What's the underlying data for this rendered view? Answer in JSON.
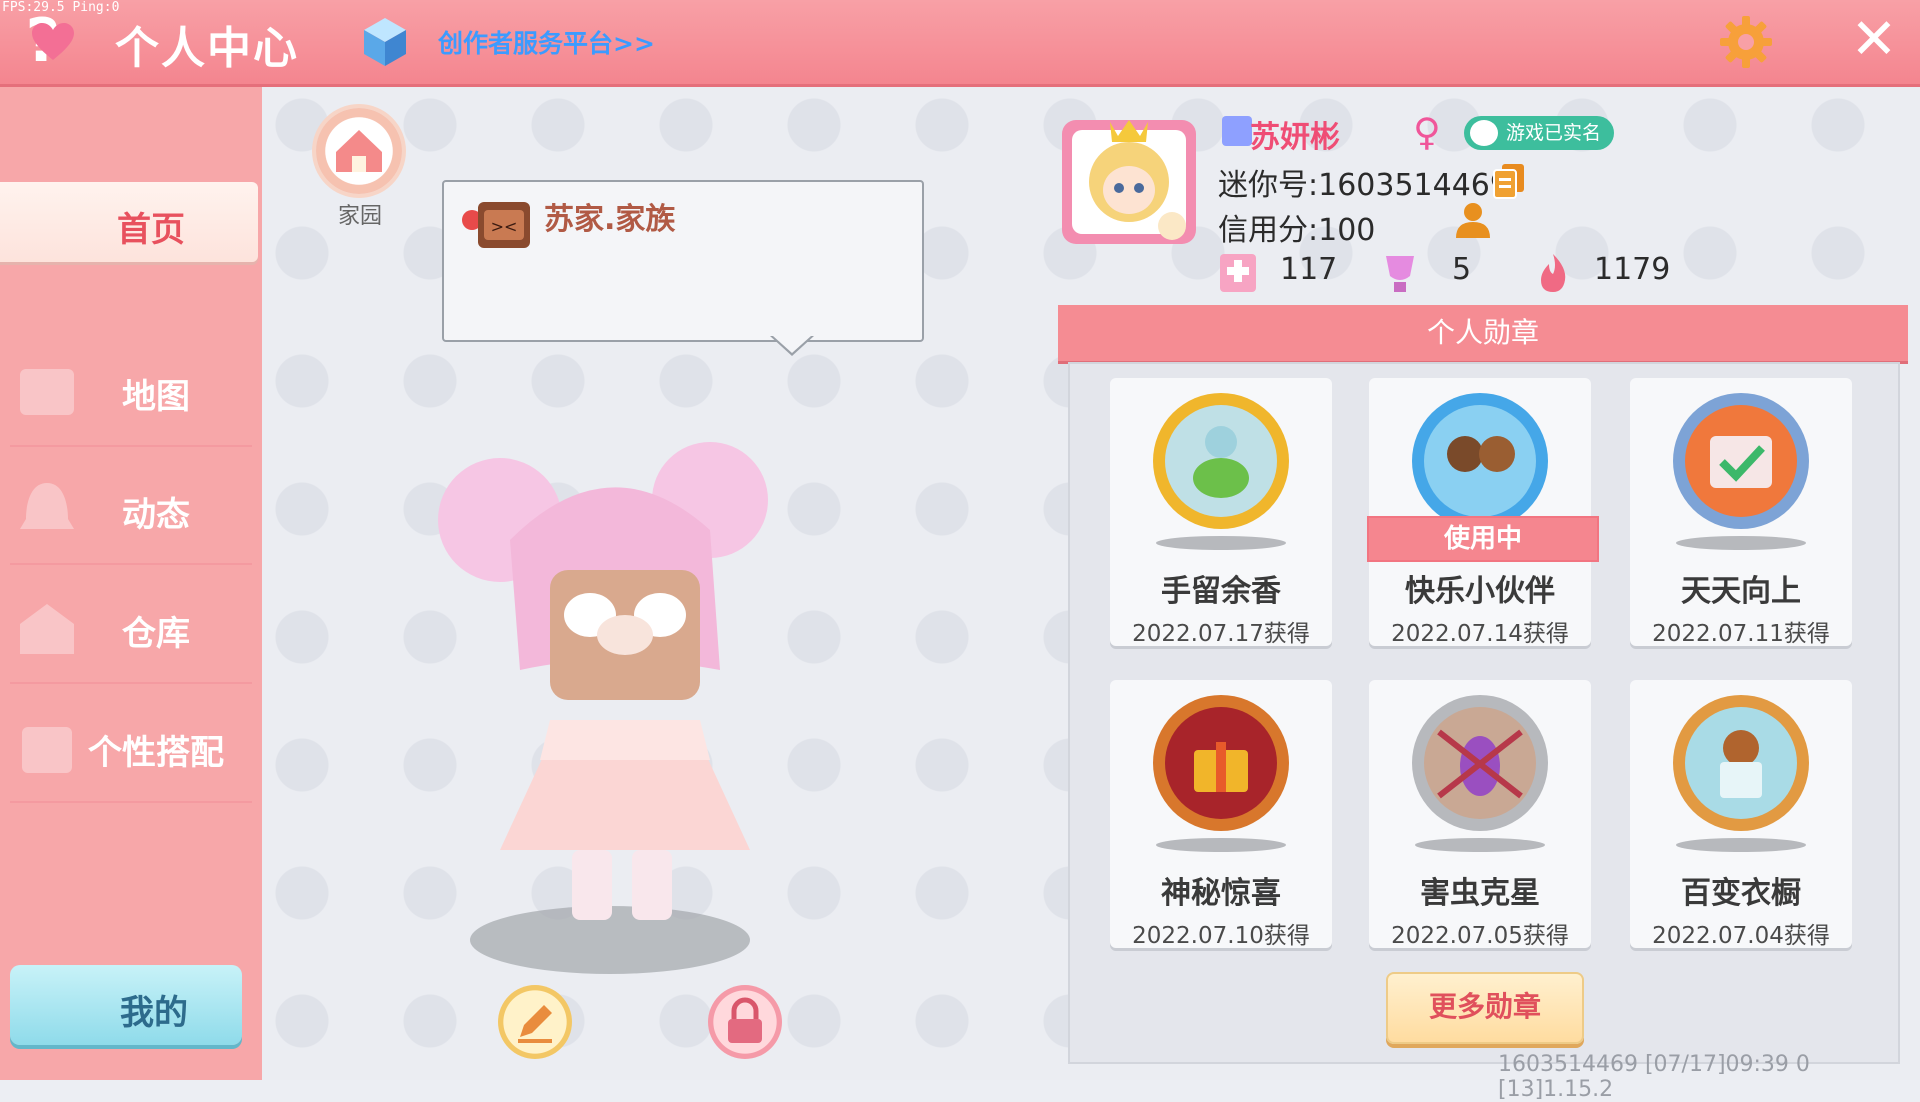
{
  "debug": {
    "fps_text": "FPS:29.5  Ping:0"
  },
  "header": {
    "help_label": "?",
    "title": "个人中心",
    "creator_link": "创作者服务平台>>",
    "close_label": "✕"
  },
  "sidebar": {
    "items": [
      {
        "label": "首页",
        "icon": "home-bg-icon",
        "selected": true
      },
      {
        "label": "地图",
        "icon": "map-bg-icon"
      },
      {
        "label": "动态",
        "icon": "bell-bg-icon"
      },
      {
        "label": "仓库",
        "icon": "storage-bg-icon"
      },
      {
        "label": "个性搭配",
        "icon": "dress-bg-icon"
      }
    ],
    "mine_label": "我的"
  },
  "home": {
    "label": "家园"
  },
  "clan": {
    "name": "苏家.家族"
  },
  "profile": {
    "name": "苏妍彬",
    "female_symbol": "♀",
    "verified_text": "游戏已实名",
    "mini_id": "迷你号:1603514469",
    "credit": "信用分:100",
    "stats": {
      "likes": "117",
      "trophies": "5",
      "popularity": "1179"
    }
  },
  "medals": {
    "title": "个人勋章",
    "in_use_label": "使用中",
    "items": [
      {
        "name": "手留余香",
        "date": "2022.07.17获得",
        "color": "#f0b62c"
      },
      {
        "name": "快乐小伙伴",
        "date": "2022.07.14获得",
        "color": "#45a7e8",
        "in_use": true
      },
      {
        "name": "天天向上",
        "date": "2022.07.11获得",
        "color": "#7da3d6"
      },
      {
        "name": "神秘惊喜",
        "date": "2022.07.10获得",
        "color": "#d8772c"
      },
      {
        "name": "害虫克星",
        "date": "2022.07.05获得",
        "color": "#b7b9bd"
      },
      {
        "name": "百变衣橱",
        "date": "2022.07.04获得",
        "color": "#e29a42"
      }
    ],
    "more_label": "更多勋章"
  },
  "footer": {
    "info": "1603514469    [07/17]09:39 0  [13]1.15.2"
  },
  "colors": {
    "accent": "#f58c93",
    "sidebar": "#f7a7a9",
    "link": "#3c9bff"
  }
}
